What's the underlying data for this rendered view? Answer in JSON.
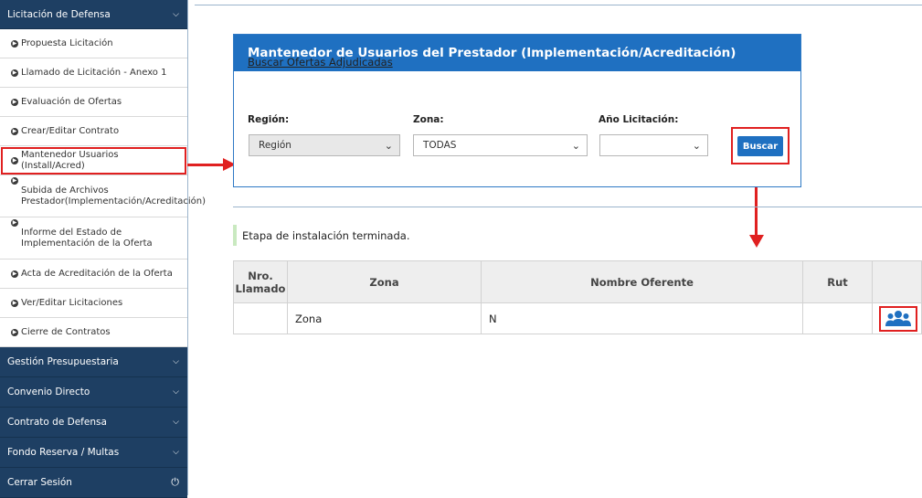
{
  "sidebar": {
    "header": "Licitación de Defensa",
    "items": [
      {
        "label": "Propuesta Licitación"
      },
      {
        "label": "Llamado de Licitación - Anexo 1"
      },
      {
        "label": "Evaluación de Ofertas"
      },
      {
        "label": "Crear/Editar Contrato"
      },
      {
        "label": "Mantenedor Usuarios (Install/Acred)"
      },
      {
        "label": "Subida de Archivos Prestador(Implementación/Acreditación)"
      },
      {
        "label": "Informe del Estado de Implementación de la Oferta"
      },
      {
        "label": "Acta de Acreditación de la Oferta"
      },
      {
        "label": "Ver/Editar Licitaciones"
      },
      {
        "label": "Cierre de Contratos"
      }
    ],
    "sections": [
      {
        "label": "Gestión Presupuestaria"
      },
      {
        "label": "Convenio Directo"
      },
      {
        "label": "Contrato de Defensa"
      },
      {
        "label": "Fondo Reserva / Multas"
      },
      {
        "label": "Cerrar Sesión"
      }
    ]
  },
  "panel": {
    "title": "Mantenedor de Usuarios del Prestador (Implementación/Acreditación)",
    "search_title": "Buscar Ofertas Adjudicadas",
    "region_label": "Región:",
    "region_value": "Región",
    "zona_label": "Zona:",
    "zona_value": "TODAS",
    "anio_label": "Año Licitación:",
    "anio_value": "",
    "search_button": "Buscar"
  },
  "status": "Etapa de instalación terminada.",
  "table": {
    "headers": [
      "Nro. Llamado",
      "Zona",
      "Nombre Oferente",
      "Rut",
      ""
    ],
    "rows": [
      [
        "",
        "Zona",
        "N",
        "",
        ""
      ]
    ]
  },
  "colors": {
    "sidebar_dark": "#1e3f63",
    "panel_blue": "#1f70c1",
    "annotation_red": "#e02020"
  }
}
